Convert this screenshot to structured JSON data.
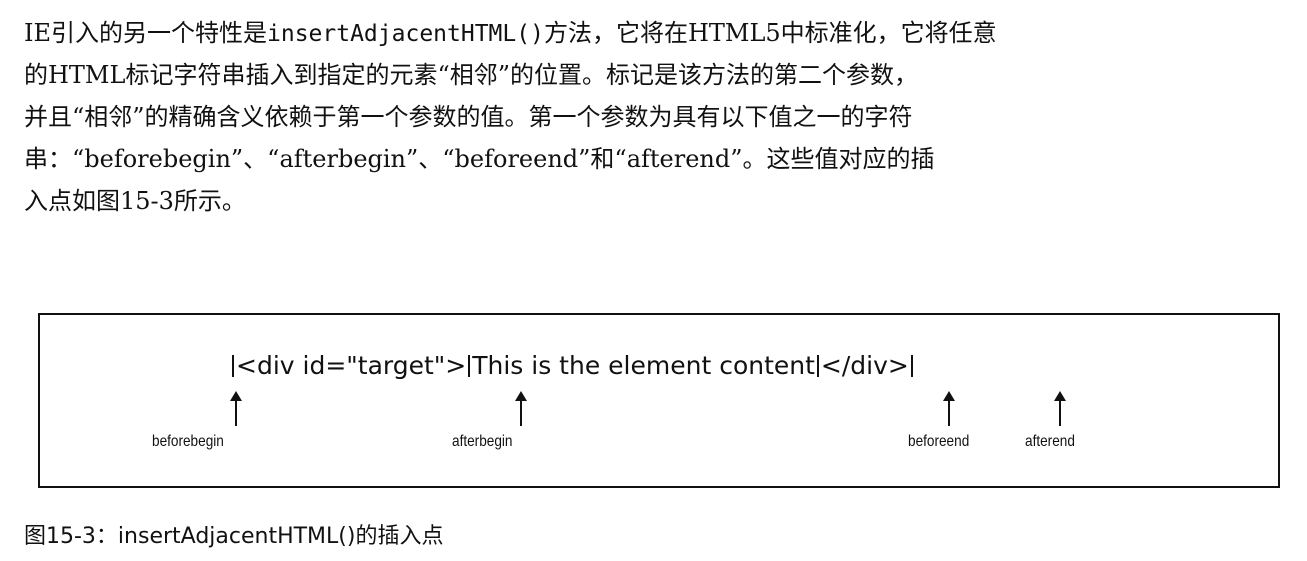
{
  "paragraph": {
    "line1": {
      "before": "IE引入的另一个特性是",
      "code": "insertAdjacentHTML()",
      "after": "方法，它将在HTML5中标准化，它将任意"
    },
    "line2": "的HTML标记字符串插入到指定的元素“相邻”的位置。标记是该方法的第二个参数，",
    "line3": "并且“相邻”的精确含义依赖于第一个参数的值。第一个参数为具有以下值之一的字符",
    "line4": "串：“beforebegin”、“afterbegin”、“beforeend”和“afterend”。这些值对应的插",
    "line5": "入点如图15-3所示。"
  },
  "figure": {
    "code": {
      "open_tag": "<div id=\"target\">",
      "content": "This is the element content",
      "close_tag": "</div>"
    },
    "markers": {
      "beforebegin": "beforebegin",
      "afterbegin": "afterbegin",
      "beforeend": "beforeend",
      "afterend": "afterend"
    },
    "caption": "图15-3：insertAdjacentHTML()的插入点"
  }
}
